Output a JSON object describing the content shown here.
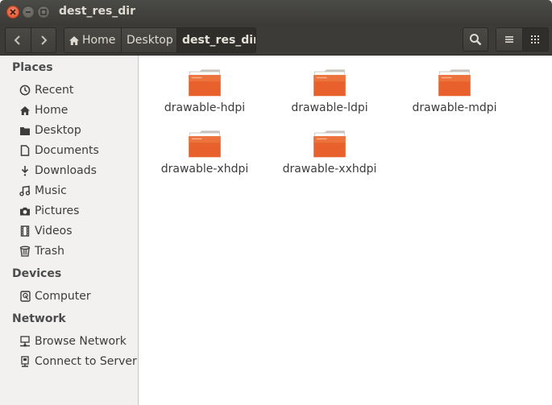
{
  "window": {
    "title": "dest_res_dir"
  },
  "toolbar": {
    "breadcrumbs": [
      {
        "label": "Home"
      },
      {
        "label": "Desktop"
      },
      {
        "label": "dest_res_dir"
      }
    ]
  },
  "sidebar": {
    "places_header": "Places",
    "places": [
      {
        "label": "Recent",
        "icon": "clock-icon"
      },
      {
        "label": "Home",
        "icon": "home-icon"
      },
      {
        "label": "Desktop",
        "icon": "desktop-folder-icon"
      },
      {
        "label": "Documents",
        "icon": "document-icon"
      },
      {
        "label": "Downloads",
        "icon": "download-icon"
      },
      {
        "label": "Music",
        "icon": "music-icon"
      },
      {
        "label": "Pictures",
        "icon": "camera-icon"
      },
      {
        "label": "Videos",
        "icon": "film-icon"
      },
      {
        "label": "Trash",
        "icon": "trash-icon"
      }
    ],
    "devices_header": "Devices",
    "devices": [
      {
        "label": "Computer",
        "icon": "drive-icon"
      }
    ],
    "network_header": "Network",
    "network": [
      {
        "label": "Browse Network",
        "icon": "network-icon"
      },
      {
        "label": "Connect to Server",
        "icon": "server-icon"
      }
    ]
  },
  "files": [
    {
      "name": "drawable-hdpi"
    },
    {
      "name": "drawable-ldpi"
    },
    {
      "name": "drawable-mdpi"
    },
    {
      "name": "drawable-xhdpi"
    },
    {
      "name": "drawable-xxhdpi"
    }
  ],
  "colors": {
    "folder_orange": "#e8612c",
    "titlebar": "#3c3b37",
    "close_button": "#e0502a"
  }
}
